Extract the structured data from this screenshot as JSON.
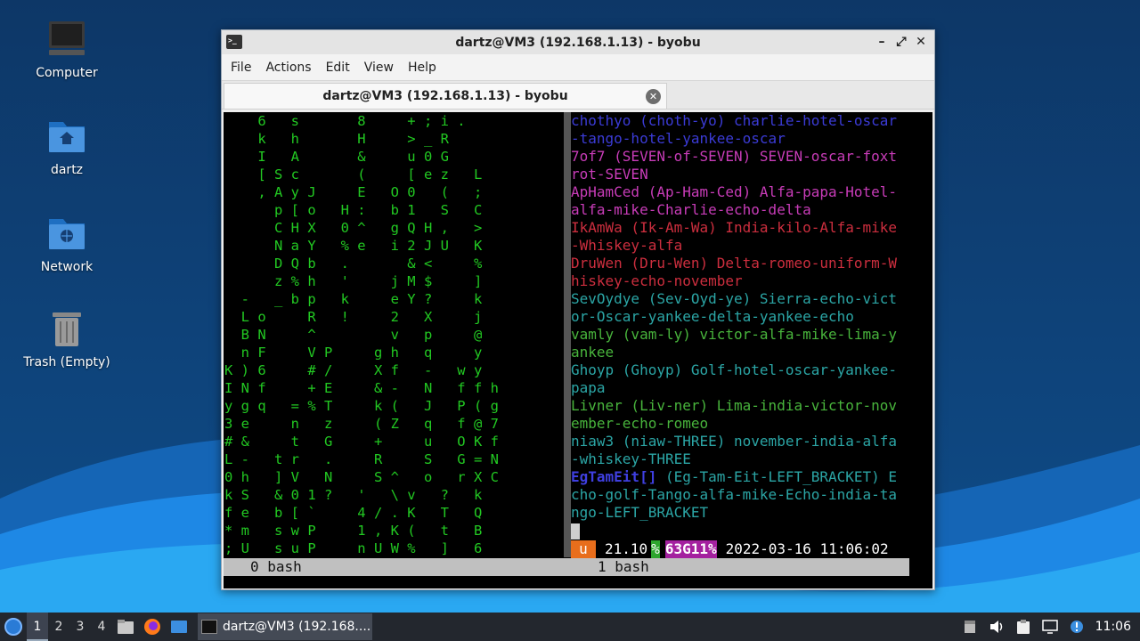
{
  "desktop": {
    "icons": [
      {
        "label": "Computer",
        "icon": "computer-icon"
      },
      {
        "label": "dartz",
        "icon": "home-folder-icon"
      },
      {
        "label": "Network",
        "icon": "network-folder-icon"
      },
      {
        "label": "Trash (Empty)",
        "icon": "trash-icon"
      }
    ]
  },
  "window": {
    "title": "dartz@VM3 (192.168.1.13) - byobu",
    "controls": {
      "minimize": "–",
      "maximize": "⤢",
      "close": "✕"
    },
    "menu": [
      "File",
      "Actions",
      "Edit",
      "View",
      "Help"
    ],
    "tab": {
      "label": "dartz@VM3 (192.168.1.13) - byobu",
      "close": "✕"
    }
  },
  "terminal": {
    "left_pane": [
      "    6   s       8     + ; i .",
      "    k   h       H     > _ R",
      "    I   A       &     u 0 G",
      "    [ S c       (     [ e z   L",
      "    , A y J     E   O 0   (   ;",
      "      p [ o   H :   b 1   S   C",
      "      C H X   0 ^   g Q H ,   >",
      "      N a Y   % e   i 2 J U   K",
      "      D Q b   .       & <     %",
      "      z % h   '     j M $     ]",
      "  -   _ b p   k     e Y ?     k",
      "  L o     R   !     2   X     j",
      "  B N     ^         v   p     @",
      "  n F     V P     g h   q     y",
      "K ) 6     # /     X f   -   w y",
      "I N f     + E     & -   N   f f h",
      "y g q   = % T     k (   J   P ( g",
      "3 e     n   z     ( Z   q   f @ 7",
      "# &     t   G     +     u   O K f",
      "L -   t r   .     R     S   G = N",
      "0 h   ] V   N     S ^   o   r X C",
      "k S   & 0 1 ?   '   \\ v   ?   k",
      "f e   b [ `     4 / . K   T   Q",
      "* m   s w P     1 , K (   t   B",
      "; U   s u P     n U W %   ]   6"
    ],
    "right_pane": [
      {
        "text": "chothyo (choth-yo) charlie-hotel-oscar",
        "color": "blue"
      },
      {
        "text": "-tango-hotel-yankee-oscar",
        "color": "blue"
      },
      {
        "text": "7of7 (SEVEN-of-SEVEN) SEVEN-oscar-foxt",
        "color": "purple"
      },
      {
        "text": "rot-SEVEN",
        "color": "purple"
      },
      {
        "text": "ApHamCed (Ap-Ham-Ced) Alfa-papa-Hotel-",
        "color": "purple"
      },
      {
        "text": "alfa-mike-Charlie-echo-delta",
        "color": "purple"
      },
      {
        "text": "IkAmWa (Ik-Am-Wa) India-kilo-Alfa-mike",
        "color": "red"
      },
      {
        "text": "-Whiskey-alfa",
        "color": "red"
      },
      {
        "text": "DruWen (Dru-Wen) Delta-romeo-uniform-W",
        "color": "red"
      },
      {
        "text": "hiskey-echo-november",
        "color": "red"
      },
      {
        "text": "SevOydye (Sev-Oyd-ye) Sierra-echo-vict",
        "color": "cyan"
      },
      {
        "text": "or-Oscar-yankee-delta-yankee-echo",
        "color": "cyan"
      },
      {
        "text": "vamly (vam-ly) victor-alfa-mike-lima-y",
        "color": "green"
      },
      {
        "text": "ankee",
        "color": "green"
      },
      {
        "text": "Ghoyp (Ghoyp) Golf-hotel-oscar-yankee-",
        "color": "cyan"
      },
      {
        "text": "papa",
        "color": "cyan"
      },
      {
        "text": "Livner (Liv-ner) Lima-india-victor-nov",
        "color": "green"
      },
      {
        "text": "ember-echo-romeo",
        "color": "green"
      },
      {
        "text": "niaw3 (niaw-THREE) november-india-alfa",
        "color": "cyan"
      },
      {
        "text": "-whiskey-THREE",
        "color": "cyan"
      },
      {
        "bold": "EgTamEit[]",
        "text": " (Eg-Tam-Eit-LEFT_BRACKET) E",
        "color": "cyan"
      },
      {
        "text": "cho-golf-Tango-alfa-mike-Echo-india-ta",
        "color": "cyan"
      },
      {
        "text": "ngo-LEFT_BRACKET",
        "color": "cyan"
      }
    ],
    "status": {
      "icon": "u",
      "load": "21.10",
      "pct": "%",
      "mem": "63G11%",
      "datetime": "2022-03-16 11:06:02"
    },
    "windows": [
      "0 bash",
      "1 bash"
    ]
  },
  "taskbar": {
    "workspaces": [
      "1",
      "2",
      "3",
      "4"
    ],
    "active_workspace": "1",
    "launchers": [
      "file-manager-icon",
      "firefox-icon",
      "desktop-icon"
    ],
    "task_label": "dartz@VM3 (192.168....",
    "tray": [
      "notes-icon",
      "volume-icon",
      "clipboard-icon",
      "network-icon",
      "update-icon"
    ],
    "clock": "11:06"
  }
}
